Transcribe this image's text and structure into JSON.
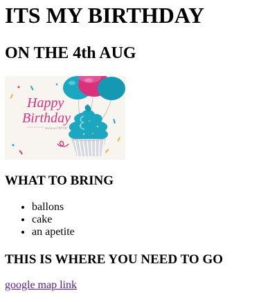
{
  "page": {
    "title": "ITS MY BIRTHDAY",
    "date_heading": "ON THE 4th AUG"
  },
  "image": {
    "caption_script_1": "Happy",
    "caption_script_2": "Birthday",
    "small_caption": "FROM ALL OF US",
    "colors": {
      "pink": "#d9327a",
      "teal": "#1aa7bf",
      "cream": "#f8f4ef",
      "gray": "#d6d7dd"
    }
  },
  "bring": {
    "heading": "WHAT TO BRING",
    "items": [
      {
        "label": "ballons"
      },
      {
        "label": "cake"
      },
      {
        "label": "an apetite"
      }
    ]
  },
  "location": {
    "heading": "THIS IS WHERE YOU NEED TO GO",
    "link_text": "google map link"
  }
}
